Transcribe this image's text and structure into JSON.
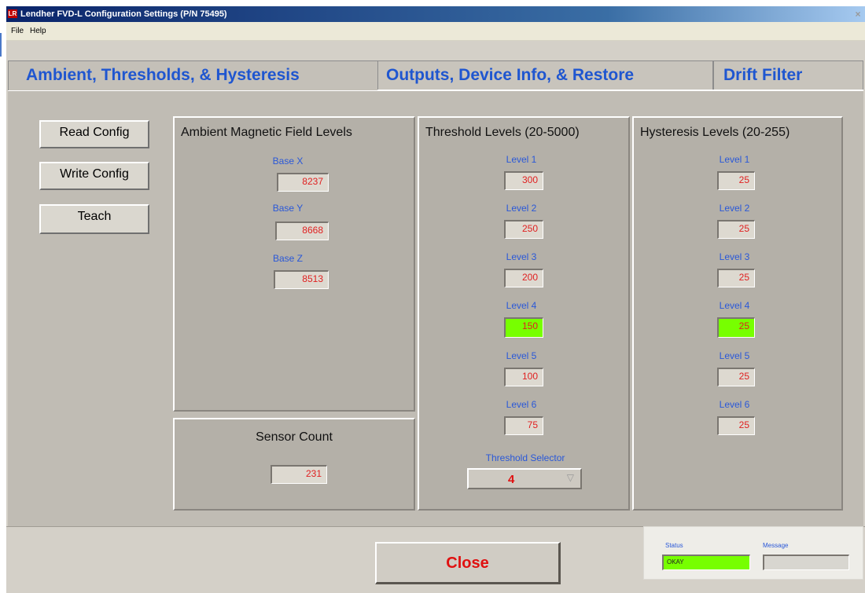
{
  "window": {
    "title": "Lendher FVD-L Configuration Settings (P/N 75495)",
    "icon_label": "LR",
    "close_glyph": "×"
  },
  "menu": {
    "items": [
      "File",
      "Help"
    ]
  },
  "tabs": [
    {
      "label": "Ambient, Thresholds, & Hysteresis",
      "active": true
    },
    {
      "label": "Outputs, Device Info, & Restore",
      "active": false
    },
    {
      "label": "Drift Filter",
      "active": false
    }
  ],
  "actions": {
    "read": "Read Config",
    "write": "Write Config",
    "teach": "Teach"
  },
  "ambient": {
    "title": "Ambient Magnetic Field  Levels",
    "base_x_label": "Base X",
    "base_x": "8237",
    "base_y_label": "Base Y",
    "base_y": "8668",
    "base_z_label": "Base Z",
    "base_z": "8513"
  },
  "sensor": {
    "title": "Sensor Count",
    "value": "231"
  },
  "thresholds": {
    "title": "Threshold Levels (20-5000)",
    "levels": [
      {
        "label": "Level 1",
        "value": "300"
      },
      {
        "label": "Level 2",
        "value": "250"
      },
      {
        "label": "Level 3",
        "value": "200"
      },
      {
        "label": "Level 4",
        "value": "150"
      },
      {
        "label": "Level 5",
        "value": "100"
      },
      {
        "label": "Level 6",
        "value": "75"
      }
    ],
    "selector_label": "Threshold Selector",
    "selector_value": "4",
    "selector_arrow": "▽"
  },
  "hysteresis": {
    "title": "Hysteresis Levels (20-255)",
    "levels": [
      {
        "label": "Level 1",
        "value": "25"
      },
      {
        "label": "Level 2",
        "value": "25"
      },
      {
        "label": "Level 3",
        "value": "25"
      },
      {
        "label": "Level 4",
        "value": "25"
      },
      {
        "label": "Level 5",
        "value": "25"
      },
      {
        "label": "Level 6",
        "value": "25"
      }
    ]
  },
  "footer": {
    "close_label": "Close",
    "status_label": "Status",
    "status_value": "OKAY",
    "message_label": "Message",
    "message_value": ""
  },
  "colors": {
    "highlight": "#77ff00",
    "value_text": "#e02020",
    "label_text": "#2a58d8"
  }
}
